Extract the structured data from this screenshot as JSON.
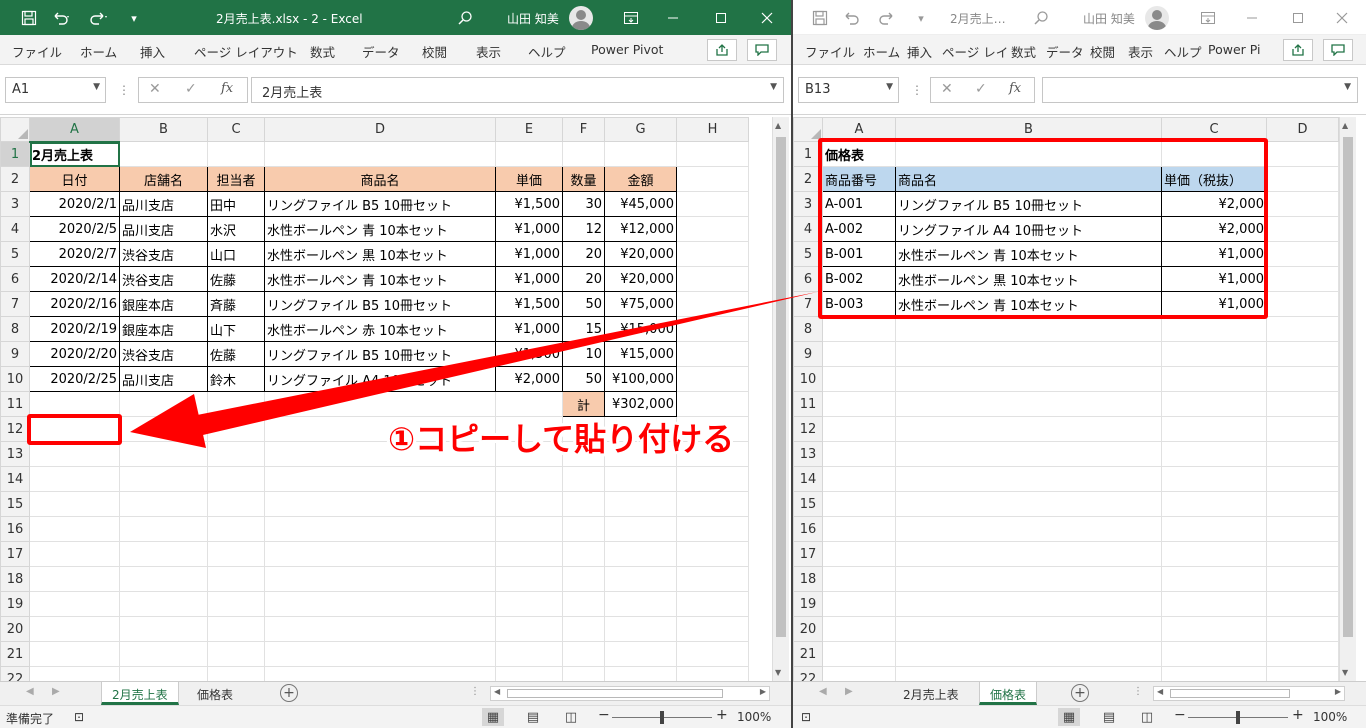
{
  "left": {
    "titlebar": {
      "title": "2月売上表.xlsx  -  2  -  Excel",
      "user": "山田 知美"
    },
    "menu": [
      "ファイル",
      "ホーム",
      "挿入",
      "ページ レイアウト",
      "数式",
      "データ",
      "校閲",
      "表示",
      "ヘルプ",
      "Power Pivot"
    ],
    "namebox": "A1",
    "formula": "2月売上表",
    "columns": [
      "A",
      "B",
      "C",
      "D",
      "E",
      "F",
      "G",
      "H"
    ],
    "rows": [
      [
        "2月売上表",
        "",
        "",
        "",
        "",
        "",
        "",
        ""
      ],
      [
        "日付",
        "店舗名",
        "担当者",
        "商品名",
        "単価",
        "数量",
        "金額",
        ""
      ],
      [
        "2020/2/1",
        "品川支店",
        "田中",
        "リングファイル B5 10冊セット",
        "¥1,500",
        "30",
        "¥45,000",
        ""
      ],
      [
        "2020/2/5",
        "品川支店",
        "水沢",
        "水性ボールペン 青 10本セット",
        "¥1,000",
        "12",
        "¥12,000",
        ""
      ],
      [
        "2020/2/7",
        "渋谷支店",
        "山口",
        "水性ボールペン 黒 10本セット",
        "¥1,000",
        "20",
        "¥20,000",
        ""
      ],
      [
        "2020/2/14",
        "渋谷支店",
        "佐藤",
        "水性ボールペン 青 10本セット",
        "¥1,000",
        "20",
        "¥20,000",
        ""
      ],
      [
        "2020/2/16",
        "銀座本店",
        "斉藤",
        "リングファイル B5 10冊セット",
        "¥1,500",
        "50",
        "¥75,000",
        ""
      ],
      [
        "2020/2/19",
        "銀座本店",
        "山下",
        "水性ボールペン 赤 10本セット",
        "¥1,000",
        "15",
        "¥15,000",
        ""
      ],
      [
        "2020/2/20",
        "渋谷支店",
        "佐藤",
        "リングファイル B5 10冊セット",
        "¥1,500",
        "10",
        "¥15,000",
        ""
      ],
      [
        "2020/2/25",
        "品川支店",
        "鈴木",
        "リングファイル A4 10冊セット",
        "¥2,000",
        "50",
        "¥100,000",
        ""
      ],
      [
        "",
        "",
        "",
        "",
        "",
        "計",
        "¥302,000",
        ""
      ]
    ],
    "row_numbers": [
      "1",
      "2",
      "3",
      "4",
      "5",
      "6",
      "7",
      "8",
      "9",
      "10",
      "11",
      "12",
      "13",
      "14",
      "15",
      "16",
      "17",
      "18",
      "19",
      "20",
      "21",
      "22"
    ],
    "tabs": [
      "2月売上表",
      "価格表"
    ],
    "status": "準備完了",
    "zoom": "100%"
  },
  "right": {
    "titlebar": {
      "title": "2月売上…",
      "user": "山田 知美"
    },
    "menu": [
      "ファイル",
      "ホーム",
      "挿入",
      "ページ レイ",
      "数式",
      "データ",
      "校閲",
      "表示",
      "ヘルプ",
      "Power Pi"
    ],
    "namebox": "B13",
    "formula": "",
    "columns": [
      "A",
      "B",
      "C",
      "D"
    ],
    "rows": [
      [
        "価格表",
        "",
        "",
        ""
      ],
      [
        "商品番号",
        "商品名",
        "単価（税抜）",
        ""
      ],
      [
        "A-001",
        "リングファイル B5 10冊セット",
        "¥2,000",
        ""
      ],
      [
        "A-002",
        "リングファイル A4 10冊セット",
        "¥2,000",
        ""
      ],
      [
        "B-001",
        "水性ボールペン 青 10本セット",
        "¥1,000",
        ""
      ],
      [
        "B-002",
        "水性ボールペン 黒 10本セット",
        "¥1,000",
        ""
      ],
      [
        "B-003",
        "水性ボールペン 青 10本セット",
        "¥1,000",
        ""
      ]
    ],
    "row_numbers": [
      "1",
      "2",
      "3",
      "4",
      "5",
      "6",
      "7",
      "8",
      "9",
      "10",
      "11",
      "12",
      "13",
      "14",
      "15",
      "16",
      "17",
      "18",
      "19",
      "20",
      "21",
      "22"
    ],
    "tabs": [
      "2月売上表",
      "価格表"
    ],
    "zoom": "100%"
  },
  "annotation": {
    "text": "①コピーして貼り付ける",
    "color": "#ff0000"
  },
  "colors": {
    "excel_green": "#217346",
    "header_orange": "#f8cbad",
    "header_blue": "#bdd7ee",
    "annotation_red": "#ff0000"
  },
  "icons": [
    "save-icon",
    "undo-icon",
    "redo-icon",
    "customize-icon",
    "search-icon",
    "user-avatar",
    "ribbon-display-icon",
    "minimize-icon",
    "maximize-icon",
    "close-icon",
    "share-icon",
    "comment-icon",
    "cancel-icon",
    "enter-icon",
    "function-icon",
    "sheet-nav-icon",
    "add-sheet-icon",
    "macro-record-icon",
    "normal-view-icon",
    "page-layout-icon",
    "page-break-icon"
  ]
}
